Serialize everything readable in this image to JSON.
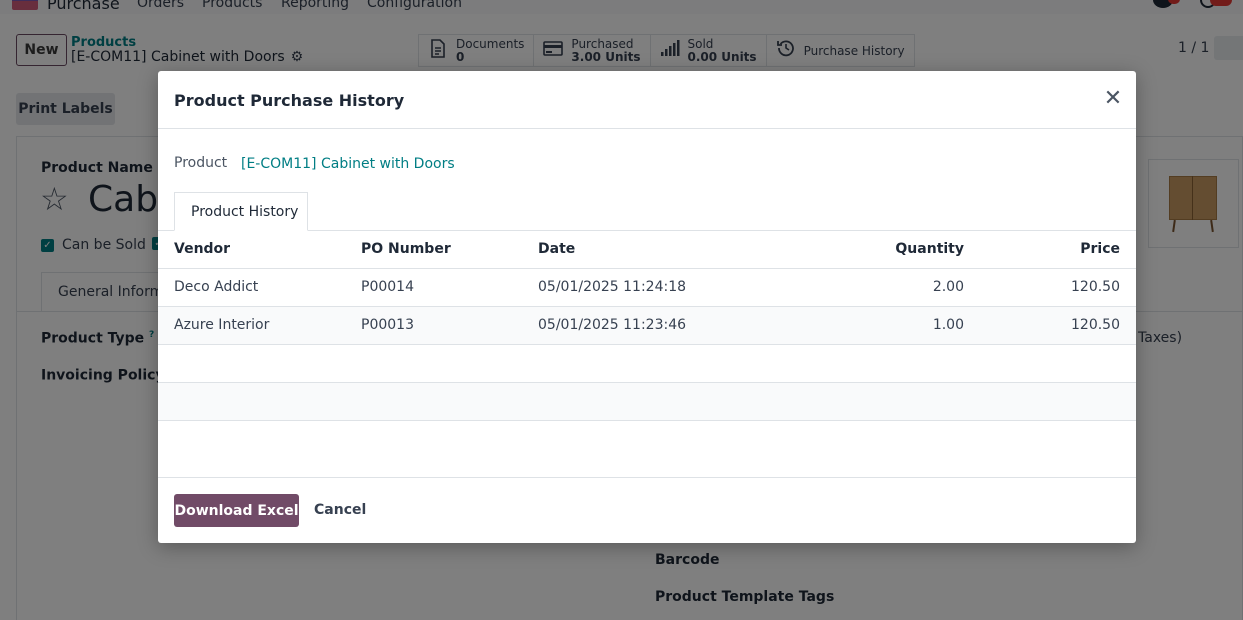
{
  "navbar": {
    "app_name": "Purchase",
    "menus": [
      "Orders",
      "Products",
      "Reporting",
      "Configuration"
    ]
  },
  "control_panel": {
    "new_label": "New",
    "breadcrumb_parent": "Products",
    "breadcrumb_current": "[E-COM11] Cabinet with Doors",
    "pager": "1 / 1",
    "smart_buttons": [
      {
        "title": "Documents",
        "value": "0",
        "icon": "document-icon"
      },
      {
        "title": "Purchased",
        "value": "3.00 Units",
        "icon": "credit-card-icon"
      },
      {
        "title": "Sold",
        "value": "0.00 Units",
        "icon": "bar-chart-icon"
      },
      {
        "title": "Purchase History",
        "value": "",
        "icon": "history-icon"
      }
    ],
    "print_labels": "Print Labels"
  },
  "form": {
    "product_name_label": "Product Name",
    "product_name_visible": "Cabi",
    "can_be_sold": "Can be Sold",
    "tab_general": "General Informa",
    "product_type_label": "Product Type",
    "invoicing_policy_label": "Invoicing Policy",
    "help_mark": "?",
    "taxes_fragment": "Taxes)",
    "barcode_label": "Barcode",
    "template_tags_label": "Product Template Tags"
  },
  "dialog": {
    "title": "Product Purchase History",
    "product_label": "Product",
    "product_value": "[E-COM11] Cabinet with Doors",
    "tab": "Product History",
    "columns": {
      "vendor": "Vendor",
      "po_number": "PO Number",
      "date": "Date",
      "quantity": "Quantity",
      "price": "Price"
    },
    "rows": [
      {
        "vendor": "Deco Addict",
        "po_number": "P00014",
        "date": "05/01/2025 11:24:18",
        "quantity": "2.00",
        "price": "120.50"
      },
      {
        "vendor": "Azure Interior",
        "po_number": "P00013",
        "date": "05/01/2025 11:23:46",
        "quantity": "1.00",
        "price": "120.50"
      }
    ],
    "download_label": "Download Excel",
    "cancel_label": "Cancel"
  },
  "colors": {
    "primary": "#714b67",
    "link": "#017e84",
    "backdrop": "rgba(0,0,0,0.5)"
  }
}
